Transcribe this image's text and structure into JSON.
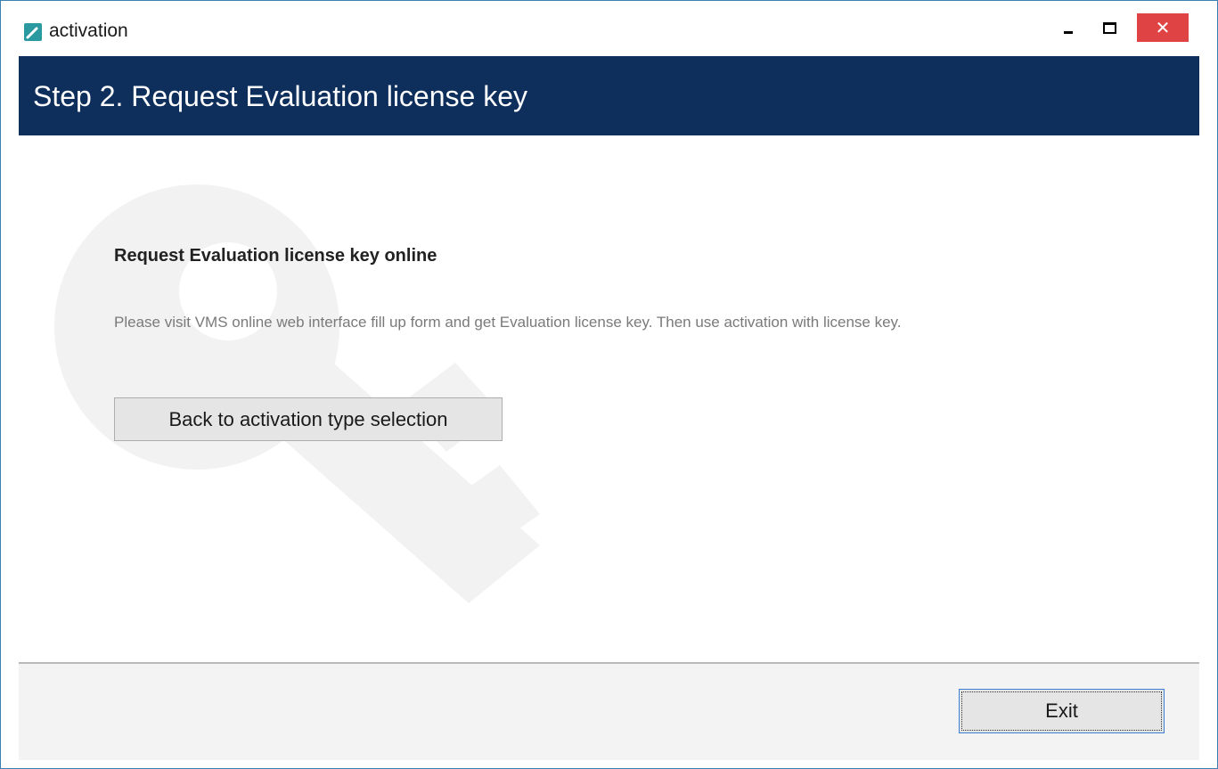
{
  "window": {
    "title": "activation",
    "icon": "activation-app-icon",
    "controls": {
      "minimize": "minimize-icon",
      "maximize": "maximize-icon",
      "close": "close-icon",
      "close_glyph": "✕",
      "close_color": "#e04343"
    }
  },
  "header": {
    "title": "Step 2. Request Evaluation license key",
    "background": "#0e2f5c"
  },
  "main": {
    "section_title": "Request Evaluation license key online",
    "description": "Please visit VMS online web interface  fill up form and get Evaluation license key. Then use activation with license key.",
    "back_button_label": "Back to activation type selection",
    "watermark_icon": "key-icon"
  },
  "footer": {
    "exit_button_label": "Exit"
  }
}
